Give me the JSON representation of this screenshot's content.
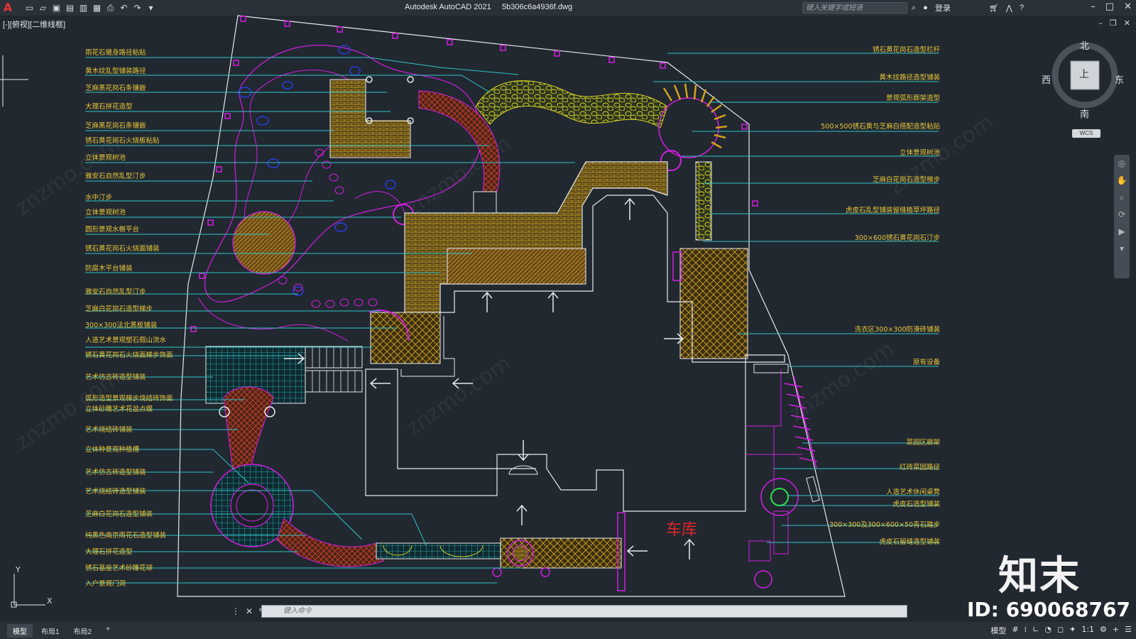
{
  "app": {
    "logo": "A",
    "title": "Autodesk AutoCAD 2021",
    "filename": "5b306c6a4936f.dwg",
    "search_placeholder": "键入关键字或短语",
    "login_label": "登录",
    "view_label": "[-][俯视][二维线框]"
  },
  "viewcube": {
    "face": "上",
    "north": "北",
    "south": "南",
    "east": "东",
    "west": "西",
    "wcs": "WCS"
  },
  "labels_left": [
    "雨花石健身路径粘贴",
    "黄木纹乱型铺装路径",
    "芝麻黑花岗石条镶嵌",
    "大理石拼花造型",
    "芝麻黑花岗石条镶嵌",
    "锈石黄花岗石火烧板粘贴",
    "立体景观树池",
    "雅安石自然乱型汀步",
    "水中汀步",
    "立体景观树池",
    "圆形景观水榭平台",
    "锈石黄花岗石火烧面铺装",
    "防腐木平台铺装",
    "雅安石自然乱型汀步",
    "芝麻白花岗石造型梯步",
    "300×300法北黑板铺装",
    "人造艺术景观塑石假山流水",
    "锈石黄花岗石火烧面梯步饰面",
    "艺术仿古砖造型铺装",
    "弧形造型景观梯步烧结砖饰面",
    "立体砂雕艺术花盆点缀",
    "艺术烧结砖铺装",
    "立体种景观种植槽",
    "艺术仿古砖造型铺装",
    "艺术烧结砖造型铺装",
    "芝麻白花岗石造型铺装",
    "纯黑色南京雨花石造型铺装",
    "大理石拼花造型",
    "锈石基座艺术砂雕花球",
    "入户景观门洞"
  ],
  "labels_right": [
    "锈石黄花岗石造型栏杆",
    "黄木纹路径造型铺装",
    "景观弧形廊架造型",
    "500×500锈石黄与芝麻白搭配造型粘贴",
    "立体景观树池",
    "芝麻白花岗石造型梯步",
    "虎皮石乱型铺装留缝植草坪路径",
    "300×600锈石黄花岗石汀步",
    "洗衣区300×300防滑砖铺装",
    "原有设备",
    "菜园区廊架",
    "红砖菜园路径",
    "人造艺术休闲桌凳",
    "虎皮石造型铺装",
    "300×300及300×600×50青石踏步",
    "虎皮石留缝造型铺装"
  ],
  "garage_label": "车库",
  "watermark": {
    "brand": "知末",
    "id": "ID: 690068767",
    "site": "znzmo.com"
  },
  "ucs": {
    "x": "X",
    "y": "Y"
  },
  "command": {
    "placeholder": "键入命令"
  },
  "tabs": [
    "模型",
    "布局1",
    "布局2",
    "+"
  ],
  "status": {
    "model": "模型",
    "scale": "1:1"
  },
  "colors": {
    "leader": "#2ec4c8",
    "label": "#e8c63a",
    "magenta": "#d21ee0",
    "hatch": "#d4a21a",
    "background": "#212830"
  }
}
